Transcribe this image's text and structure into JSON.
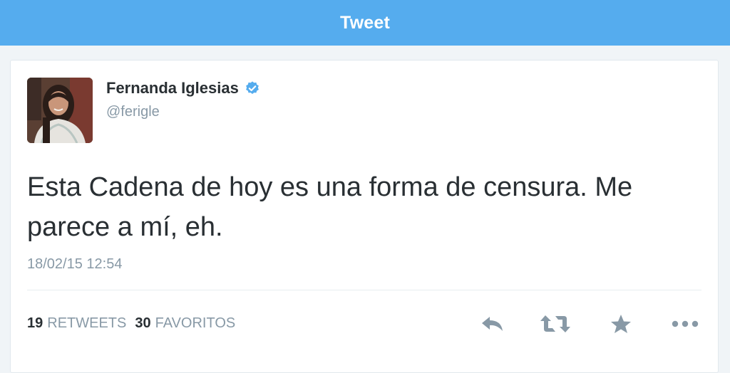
{
  "header": {
    "title": "Tweet"
  },
  "tweet": {
    "author": {
      "display_name": "Fernanda Iglesias",
      "handle": "@ferigle",
      "verified": true
    },
    "text": "Esta Cadena de hoy es una forma de censura. Me parece a mí, eh.",
    "timestamp": "18/02/15 12:54",
    "stats": {
      "retweets_count": "19",
      "retweets_label": "RETWEETS",
      "favorites_count": "30",
      "favorites_label": "FAVORITOS"
    },
    "actions": [
      {
        "icon": "reply-icon"
      },
      {
        "icon": "retweet-icon"
      },
      {
        "icon": "star-icon"
      },
      {
        "icon": "more-icon"
      }
    ]
  },
  "colors": {
    "brand": "#55acee",
    "text": "#292f33",
    "muted": "#8899a6",
    "icon": "#8899a6"
  }
}
